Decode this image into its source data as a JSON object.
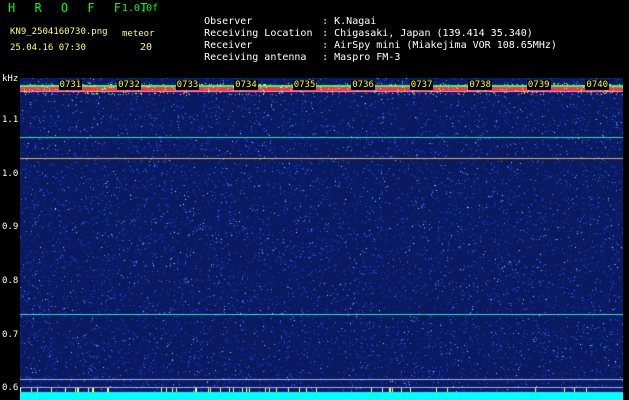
{
  "header": {
    "app_title": "H R O F F T",
    "version": "1.0.0f",
    "filename": "KN9_2504160730.png",
    "datetime": "25.04.16 07:30",
    "meteor_label": "meteor",
    "meteor_count": "20"
  },
  "meta": [
    {
      "key": "Observer",
      "value": ": K.Nagai"
    },
    {
      "key": "Receiving Location",
      "value": ": Chigasaki, Japan (139.414 35.340)"
    },
    {
      "key": "Receiver",
      "value": ": AirSpy mini (Miakejima VOR 108.65MHz)"
    },
    {
      "key": "Receiving antenna",
      "value": ": Maspro FM-3"
    }
  ],
  "chart_data": {
    "type": "heatmap",
    "ylabel": "kHz",
    "y_ticks": [
      "1.1",
      "1.0",
      "0.9",
      "0.8",
      "0.7",
      "0.6"
    ],
    "y_tick_values": [
      1.1,
      1.0,
      0.9,
      0.8,
      0.7,
      0.6
    ],
    "ylim": [
      0.58,
      1.18
    ],
    "x_ticks": [
      "0731",
      "0732",
      "0733",
      "0734",
      "0735",
      "0736",
      "0737",
      "0738",
      "0739",
      "0740"
    ],
    "x_tick_values": [
      1,
      2,
      3,
      4,
      5,
      6,
      7,
      8,
      9,
      10
    ],
    "xlim": [
      0,
      10.3
    ],
    "bands": [
      {
        "freq": 1.16,
        "color": "#ff3040"
      },
      {
        "freq": 1.07,
        "color": "#40ffd0"
      },
      {
        "freq": 1.03,
        "color": "#ffd040"
      },
      {
        "freq": 0.74,
        "color": "#40ffd0"
      },
      {
        "freq": 0.62,
        "color": "#c0c0ff"
      },
      {
        "freq": 0.605,
        "color": "#c0c0ff"
      }
    ],
    "colors": {
      "background": "#0a1a60",
      "noise": "#2050ff",
      "bright": "#40ffd0",
      "floor": "#00ffff"
    }
  }
}
